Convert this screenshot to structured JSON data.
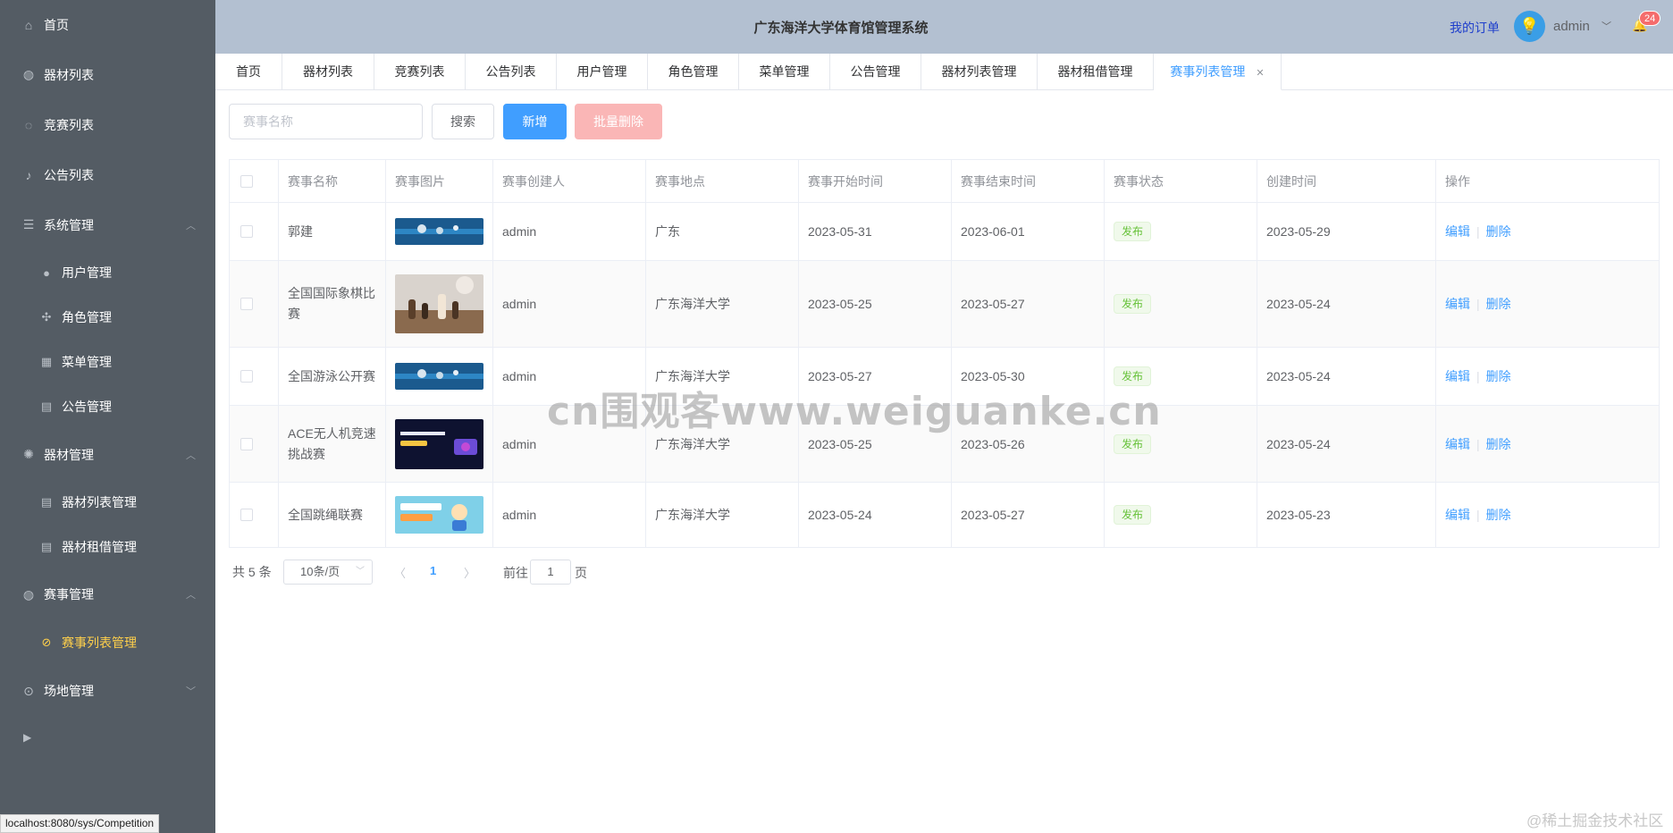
{
  "sidebar": {
    "items": [
      {
        "label": "首页",
        "icon": "home-icon"
      },
      {
        "label": "器材列表",
        "icon": "basketball-icon"
      },
      {
        "label": "竞赛列表",
        "icon": "baseball-icon"
      },
      {
        "label": "公告列表",
        "icon": "bell-icon"
      },
      {
        "label": "系统管理",
        "icon": "sliders-icon",
        "expanded": true
      },
      {
        "label": "用户管理",
        "icon": "user-icon"
      },
      {
        "label": "角色管理",
        "icon": "rank-icon"
      },
      {
        "label": "菜单管理",
        "icon": "menu-grid-icon"
      },
      {
        "label": "公告管理",
        "icon": "document-icon"
      },
      {
        "label": "器材管理",
        "icon": "gear-icon",
        "expanded": true
      },
      {
        "label": "器材列表管理",
        "icon": "document-icon"
      },
      {
        "label": "器材租借管理",
        "icon": "document-icon"
      },
      {
        "label": "赛事管理",
        "icon": "basketball-icon",
        "expanded": true
      },
      {
        "label": "赛事列表管理",
        "icon": "football-icon",
        "active": true
      },
      {
        "label": "场地管理",
        "icon": "location-icon",
        "expanded": false
      }
    ]
  },
  "status_url": "localhost:8080/sys/Competition",
  "header": {
    "title": "广东海洋大学体育馆管理系统",
    "my_orders": "我的订单",
    "username": "admin",
    "notification_count": "24"
  },
  "tabs": [
    {
      "label": "首页"
    },
    {
      "label": "器材列表"
    },
    {
      "label": "竞赛列表"
    },
    {
      "label": "公告列表"
    },
    {
      "label": "用户管理"
    },
    {
      "label": "角色管理"
    },
    {
      "label": "菜单管理"
    },
    {
      "label": "公告管理"
    },
    {
      "label": "器材列表管理"
    },
    {
      "label": "器材租借管理"
    },
    {
      "label": "赛事列表管理",
      "active": true
    }
  ],
  "toolbar": {
    "search_placeholder": "赛事名称",
    "search_label": "搜索",
    "add_label": "新增",
    "batch_delete_label": "批量删除"
  },
  "table": {
    "columns": [
      "赛事名称",
      "赛事图片",
      "赛事创建人",
      "赛事地点",
      "赛事开始时间",
      "赛事结束时间",
      "赛事状态",
      "创建时间",
      "操作"
    ],
    "rows": [
      {
        "name": "郭建",
        "creator": "admin",
        "location": "广东",
        "start": "2023-05-31",
        "end": "2023-06-01",
        "status": "发布",
        "created": "2023-05-29"
      },
      {
        "name": "全国国际象棋比赛",
        "creator": "admin",
        "location": "广东海洋大学",
        "start": "2023-05-25",
        "end": "2023-05-27",
        "status": "发布",
        "created": "2023-05-24"
      },
      {
        "name": "全国游泳公开赛",
        "creator": "admin",
        "location": "广东海洋大学",
        "start": "2023-05-27",
        "end": "2023-05-30",
        "status": "发布",
        "created": "2023-05-24"
      },
      {
        "name": "ACE无人机竞速挑战赛",
        "creator": "admin",
        "location": "广东海洋大学",
        "start": "2023-05-25",
        "end": "2023-05-26",
        "status": "发布",
        "created": "2023-05-24"
      },
      {
        "name": "全国跳绳联赛",
        "creator": "admin",
        "location": "广东海洋大学",
        "start": "2023-05-24",
        "end": "2023-05-27",
        "status": "发布",
        "created": "2023-05-23"
      }
    ],
    "edit_label": "编辑",
    "delete_label": "删除"
  },
  "pagination": {
    "total_text": "共 5 条",
    "page_size": "10条/页",
    "current_page": "1",
    "goto_label": "前往",
    "goto_value": "1",
    "goto_suffix": "页"
  },
  "watermark": "cn围观客www.weiguanke.cn",
  "corner_mark": "@稀土掘金技术社区",
  "colors": {
    "sidebar_bg": "#545c64",
    "header_bg": "#b3c0d1",
    "primary": "#409eff",
    "active_menu": "#ffd04b",
    "danger_light": "#fab6b6",
    "success": "#67c23a"
  }
}
